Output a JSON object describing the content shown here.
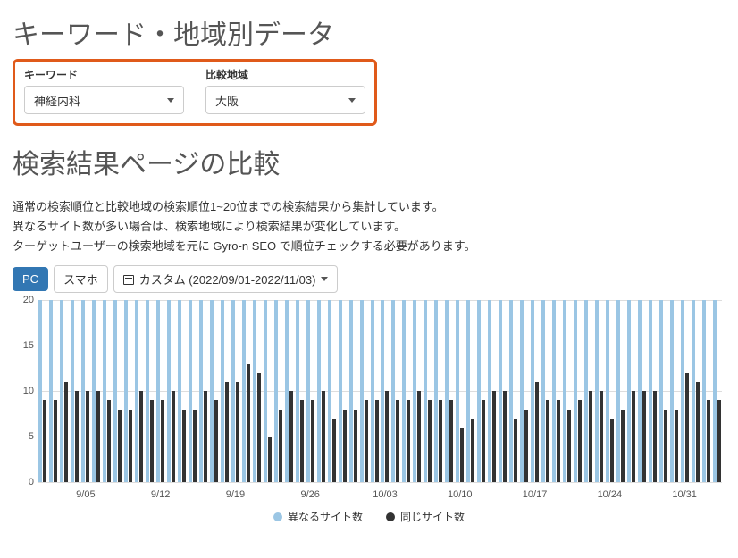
{
  "heading1": "キーワード・地域別データ",
  "filters": {
    "keyword_label": "キーワード",
    "keyword_value": "神経内科",
    "region_label": "比較地域",
    "region_value": "大阪"
  },
  "heading2": "検索結果ページの比較",
  "desc_line1": "通常の検索順位と比較地域の検索順位1~20位までの検索結果から集計しています。",
  "desc_line2": "異なるサイト数が多い場合は、検索地域により検索結果が変化しています。",
  "desc_line3": "ターゲットユーザーの検索地域を元に Gyro-n SEO で順位チェックする必要があります。",
  "tabs": {
    "pc": "PC",
    "sp": "スマホ"
  },
  "date_range": "カスタム (2022/09/01-2022/11/03)",
  "legend": {
    "diff": "異なるサイト数",
    "same": "同じサイト数"
  },
  "chart_data": {
    "type": "bar",
    "ylabel": "",
    "xlabel": "",
    "ylim": [
      0,
      20
    ],
    "y_ticks": [
      0,
      5,
      10,
      15,
      20
    ],
    "x_tick_indices": [
      4,
      11,
      18,
      25,
      32,
      39,
      46,
      53,
      60
    ],
    "x_tick_labels": [
      "9/05",
      "9/12",
      "9/19",
      "9/26",
      "10/03",
      "10/10",
      "10/17",
      "10/24",
      "10/31"
    ],
    "series": [
      {
        "name": "異なるサイト数",
        "color": "#9bc6e4",
        "values": [
          20,
          20,
          20,
          20,
          20,
          20,
          20,
          20,
          20,
          20,
          20,
          20,
          20,
          20,
          20,
          20,
          20,
          20,
          20,
          20,
          20,
          20,
          20,
          20,
          20,
          20,
          20,
          20,
          20,
          20,
          20,
          20,
          20,
          20,
          20,
          20,
          20,
          20,
          20,
          20,
          20,
          20,
          20,
          20,
          20,
          20,
          20,
          20,
          20,
          20,
          20,
          20,
          20,
          20,
          20,
          20,
          20,
          20,
          20,
          20,
          20,
          20,
          20,
          20
        ]
      },
      {
        "name": "同じサイト数",
        "color": "#333333",
        "values": [
          9,
          9,
          11,
          10,
          10,
          10,
          9,
          8,
          8,
          10,
          9,
          9,
          10,
          8,
          8,
          10,
          9,
          11,
          11,
          13,
          12,
          5,
          8,
          10,
          9,
          9,
          10,
          7,
          8,
          8,
          9,
          9,
          10,
          9,
          9,
          10,
          9,
          9,
          9,
          6,
          7,
          9,
          10,
          10,
          7,
          8,
          11,
          9,
          9,
          8,
          9,
          10,
          10,
          7,
          8,
          10,
          10,
          10,
          8,
          8,
          12,
          11,
          9,
          9
        ]
      }
    ]
  }
}
